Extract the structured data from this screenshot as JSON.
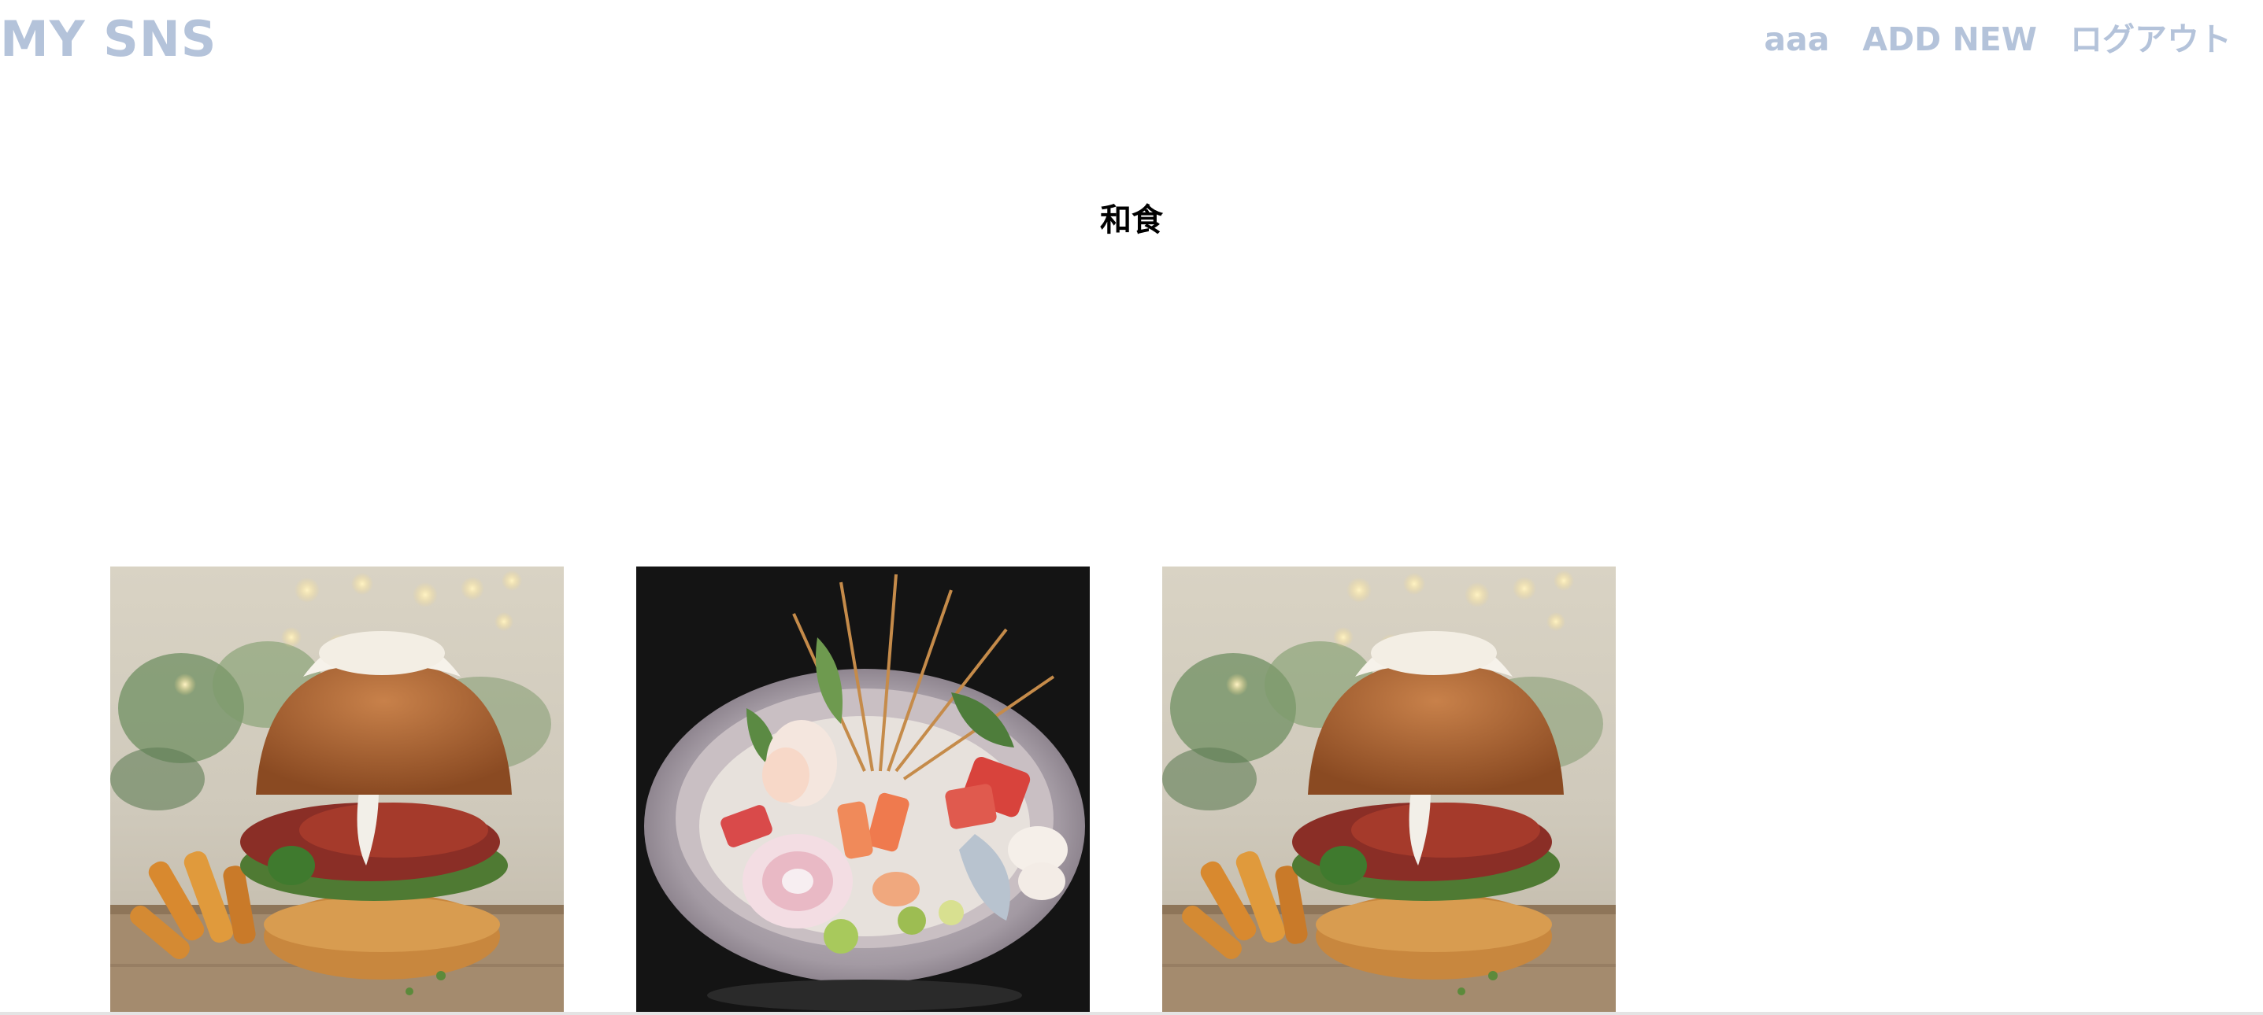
{
  "header": {
    "logo": "MY SNS",
    "nav": {
      "user": "aaa",
      "add_new": "ADD NEW",
      "logout": "ログアウト"
    }
  },
  "main": {
    "title": "和食",
    "posts": [
      {
        "image": "burger-photo"
      },
      {
        "image": "sashimi-platter-photo"
      },
      {
        "image": "burger-photo"
      }
    ]
  },
  "colors": {
    "nav_text": "#b4c3da",
    "title_text": "#000000",
    "background": "#ffffff"
  }
}
